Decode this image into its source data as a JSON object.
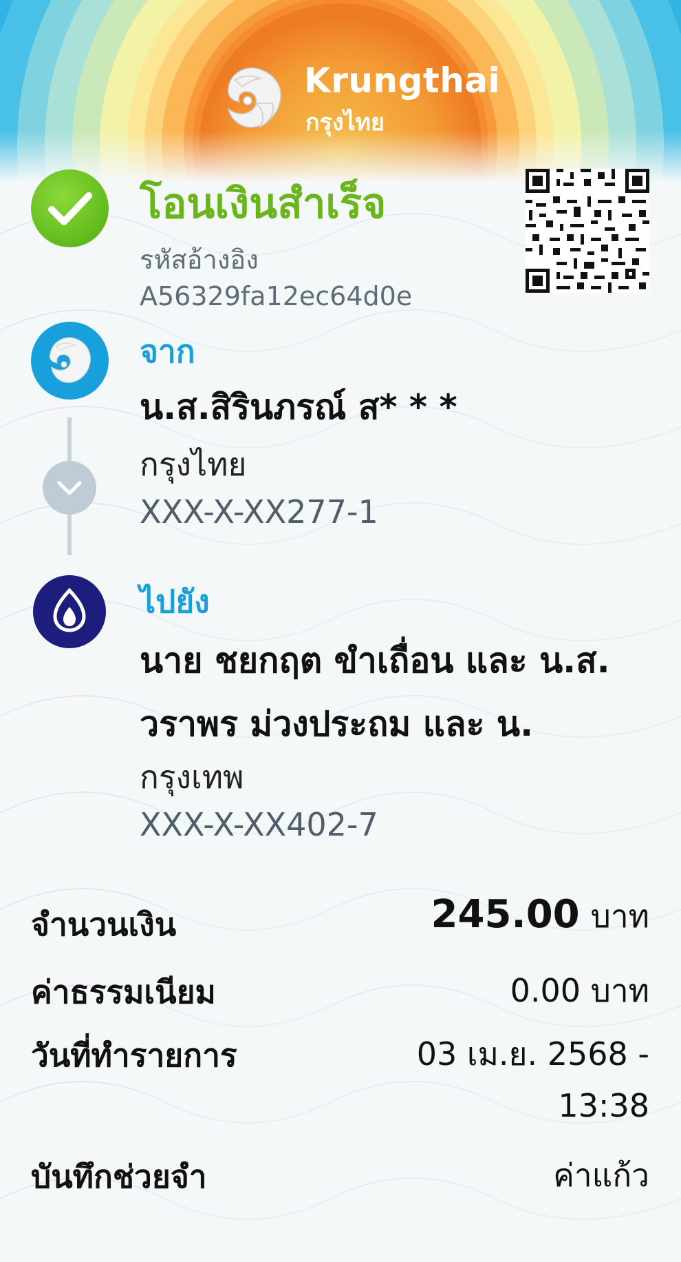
{
  "brand": {
    "name_en": "Krungthai",
    "name_th": "กรุงไทย"
  },
  "status": {
    "title": "โอนเงินสำเร็จ",
    "ref_label": "รหัสอ้างอิง",
    "ref_value": "A56329fa12ec64d0e"
  },
  "from": {
    "label": "จาก",
    "name": "น.ส.สิรินภรณ์ ส* * *",
    "bank": "กรุงไทย",
    "account": "XXX-X-XX277-1"
  },
  "to": {
    "label": "ไปยัง",
    "name_line1": "นาย ชยกฤต ขำเถื่อน และ น.ส.",
    "name_line2": "วราพร ม่วงประถม และ น.",
    "bank": "กรุงเทพ",
    "account": "XXX-X-XX402-7"
  },
  "details": {
    "amount_label": "จำนวนเงิน",
    "amount_value": "245.00",
    "amount_unit": "บาท",
    "fee_label": "ค่าธรรมเนียม",
    "fee_value": "0.00 บาท",
    "date_label": "วันที่ทำรายการ",
    "date_value": "03 เม.ย. 2568 -",
    "time_value": "13:38",
    "memo_label": "บันทึกช่วยจำ",
    "memo_value": "ค่าแก้ว"
  },
  "colors": {
    "success_green": "#6ab41c",
    "accent_blue": "#1aa0d8",
    "krungthai_blue": "#17a0dc",
    "bbl_navy": "#1c1d7c",
    "muted_text": "#4f5e6a"
  },
  "icons": {
    "success": "check-circle-icon",
    "from_bank": "krungthai-bird-logo-icon",
    "expand": "chevron-down-icon",
    "to_bank": "bangkok-bank-lotus-logo-icon",
    "qr": "qr-code-icon"
  }
}
